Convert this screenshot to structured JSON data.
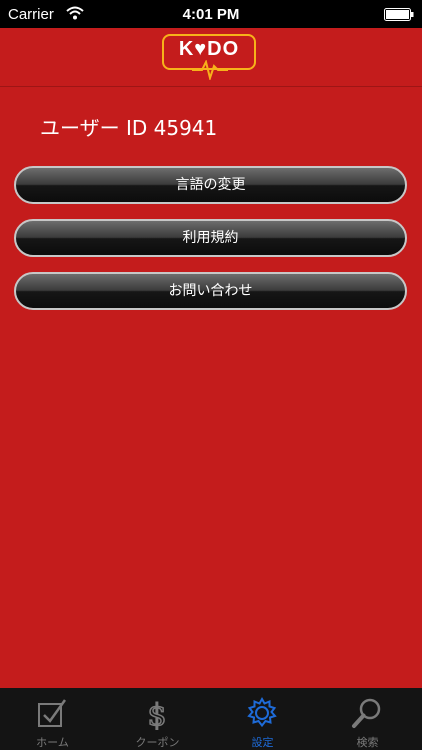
{
  "status_bar": {
    "carrier": "Carrier",
    "time": "4:01 PM"
  },
  "header": {
    "logo_text": "K♥DO",
    "logo_accent_color": "#f7b21a"
  },
  "user": {
    "id_label": "ユーザー ID 45941"
  },
  "menu": {
    "change_language": "言語の変更",
    "terms_of_use": "利用規約",
    "contact": "お問い合わせ"
  },
  "tab_bar": {
    "active_color": "#1e6bd8",
    "tabs": [
      {
        "label": "ホーム",
        "icon": "home-check-icon"
      },
      {
        "label": "クーポン",
        "icon": "dollar-icon"
      },
      {
        "label": "設定",
        "icon": "gear-icon"
      },
      {
        "label": "検索",
        "icon": "search-icon"
      }
    ]
  },
  "colors": {
    "background": "#c41c1c"
  }
}
